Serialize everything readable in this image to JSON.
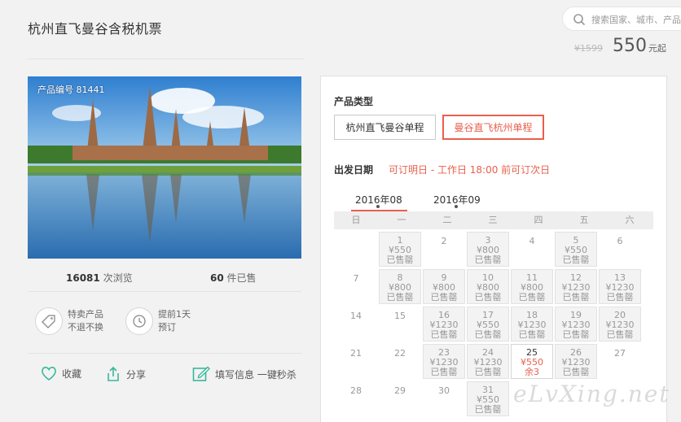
{
  "header": {
    "title": "杭州直飞曼谷含税机票",
    "search_placeholder": "搜索国家、城市、产品",
    "old_price": "¥1599",
    "price": "550",
    "price_suffix": "元起"
  },
  "product": {
    "code_label": "产品编号 81441",
    "views_count": "16081",
    "views_label": "次浏览",
    "sold_count": "60",
    "sold_label": "件已售",
    "features": [
      {
        "line1": "特卖产品",
        "line2": "不退不换",
        "icon": "tag-icon"
      },
      {
        "line1": "提前1天",
        "line2": "预订",
        "icon": "clock-icon"
      }
    ],
    "actions": {
      "favorite": "收藏",
      "share": "分享",
      "fill_info": "填写信息 一键秒杀"
    }
  },
  "booking": {
    "type_label": "产品类型",
    "types": [
      "杭州直飞曼谷单程",
      "曼谷直飞杭州单程"
    ],
    "selected_type": 1,
    "date_label": "出发日期",
    "date_note": "可订明日 - 工作日 18:00 前可订次日",
    "months": [
      "2016年08",
      "2016年09"
    ],
    "active_month": 0,
    "weekdays": [
      "日",
      "一",
      "二",
      "三",
      "四",
      "五",
      "六"
    ],
    "days": [
      {
        "d": "1",
        "col": 1,
        "row": 0,
        "p": "¥550",
        "s": "已售罄",
        "state": "soldout"
      },
      {
        "d": "2",
        "col": 2,
        "row": 0,
        "state": "none"
      },
      {
        "d": "3",
        "col": 3,
        "row": 0,
        "p": "¥800",
        "s": "已售罄",
        "state": "soldout"
      },
      {
        "d": "4",
        "col": 4,
        "row": 0,
        "state": "none"
      },
      {
        "d": "5",
        "col": 5,
        "row": 0,
        "p": "¥550",
        "s": "已售罄",
        "state": "soldout"
      },
      {
        "d": "6",
        "col": 6,
        "row": 0,
        "state": "none"
      },
      {
        "d": "7",
        "col": 0,
        "row": 1,
        "state": "none"
      },
      {
        "d": "8",
        "col": 1,
        "row": 1,
        "p": "¥800",
        "s": "已售罄",
        "state": "soldout"
      },
      {
        "d": "9",
        "col": 2,
        "row": 1,
        "p": "¥800",
        "s": "已售罄",
        "state": "soldout"
      },
      {
        "d": "10",
        "col": 3,
        "row": 1,
        "p": "¥800",
        "s": "已售罄",
        "state": "soldout"
      },
      {
        "d": "11",
        "col": 4,
        "row": 1,
        "p": "¥800",
        "s": "已售罄",
        "state": "soldout"
      },
      {
        "d": "12",
        "col": 5,
        "row": 1,
        "p": "¥1230",
        "s": "已售罄",
        "state": "soldout"
      },
      {
        "d": "13",
        "col": 6,
        "row": 1,
        "p": "¥1230",
        "s": "已售罄",
        "state": "soldout"
      },
      {
        "d": "14",
        "col": 0,
        "row": 2,
        "state": "none"
      },
      {
        "d": "15",
        "col": 1,
        "row": 2,
        "state": "none"
      },
      {
        "d": "16",
        "col": 2,
        "row": 2,
        "p": "¥1230",
        "s": "已售罄",
        "state": "soldout"
      },
      {
        "d": "17",
        "col": 3,
        "row": 2,
        "p": "¥550",
        "s": "已售罄",
        "state": "soldout"
      },
      {
        "d": "18",
        "col": 4,
        "row": 2,
        "p": "¥1230",
        "s": "已售罄",
        "state": "soldout"
      },
      {
        "d": "19",
        "col": 5,
        "row": 2,
        "p": "¥1230",
        "s": "已售罄",
        "state": "soldout"
      },
      {
        "d": "20",
        "col": 6,
        "row": 2,
        "p": "¥1230",
        "s": "已售罄",
        "state": "soldout"
      },
      {
        "d": "21",
        "col": 0,
        "row": 3,
        "state": "none"
      },
      {
        "d": "22",
        "col": 1,
        "row": 3,
        "state": "none"
      },
      {
        "d": "23",
        "col": 2,
        "row": 3,
        "p": "¥1230",
        "s": "已售罄",
        "state": "soldout"
      },
      {
        "d": "24",
        "col": 3,
        "row": 3,
        "p": "¥1230",
        "s": "已售罄",
        "state": "soldout"
      },
      {
        "d": "25",
        "col": 4,
        "row": 3,
        "p": "¥550",
        "s": "余3",
        "state": "available"
      },
      {
        "d": "26",
        "col": 5,
        "row": 3,
        "p": "¥1230",
        "s": "已售罄",
        "state": "soldout"
      },
      {
        "d": "27",
        "col": 6,
        "row": 3,
        "state": "none"
      },
      {
        "d": "28",
        "col": 0,
        "row": 4,
        "state": "none"
      },
      {
        "d": "29",
        "col": 1,
        "row": 4,
        "state": "none"
      },
      {
        "d": "30",
        "col": 2,
        "row": 4,
        "state": "none"
      },
      {
        "d": "31",
        "col": 3,
        "row": 4,
        "p": "¥550",
        "s": "已售罄",
        "state": "soldout"
      }
    ]
  },
  "watermark": "eLvXing.net",
  "colors": {
    "accent": "#e8604c",
    "green": "#3bb79a"
  }
}
